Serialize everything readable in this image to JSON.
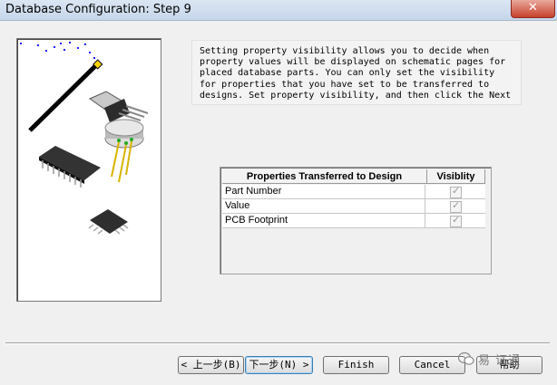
{
  "window": {
    "title": "Database Configuration: Step 9",
    "close_label": "✕"
  },
  "description": "Setting property visibility allows you to decide when\nproperty values will be displayed on schematic pages for\nplaced database parts. You can only set the visibility\nfor properties that you have set to be transferred to\ndesigns. Set property visibility, and then click the Next",
  "grid": {
    "columns": [
      "Properties Transferred to Design",
      "Visiblity"
    ],
    "rows": [
      {
        "name": "Part Number",
        "visible": true
      },
      {
        "name": "Value",
        "visible": true
      },
      {
        "name": "PCB Footprint",
        "visible": true
      }
    ]
  },
  "buttons": {
    "back": "< 上一步(B)",
    "next": "下一步(N) >",
    "finish": "Finish",
    "cancel": "Cancel",
    "help": "帮助"
  },
  "watermark": {
    "text": "易  证通"
  }
}
